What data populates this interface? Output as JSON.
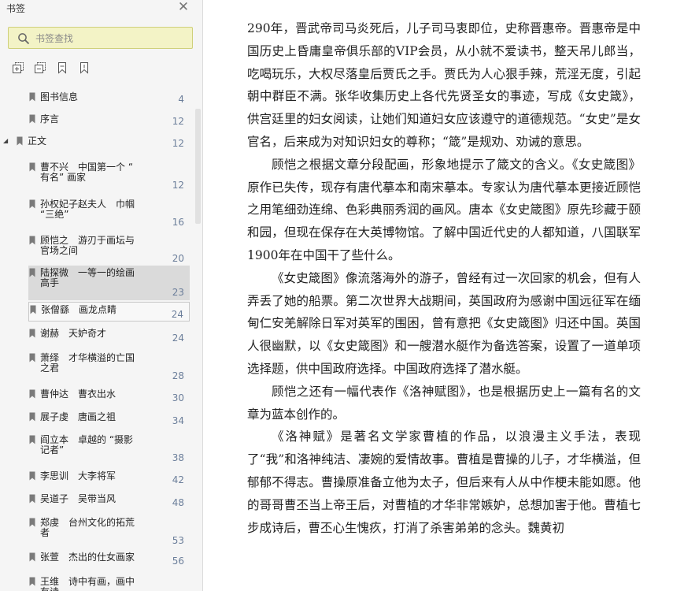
{
  "sidebar": {
    "title": "书签",
    "search": {
      "placeholder": "书签查找",
      "value": ""
    },
    "toolbar": [
      {
        "icon": "expand-all-bookmarks-icon"
      },
      {
        "icon": "collapse-all-bookmarks-icon"
      },
      {
        "icon": "bookmark-icon"
      },
      {
        "icon": "add-bookmark-icon"
      }
    ],
    "items": [
      {
        "label": "图书信息",
        "page": "4"
      },
      {
        "label": "序言",
        "page": "12"
      },
      {
        "label": "正文",
        "page": "12",
        "expanded": true
      },
      {
        "label": "曹不兴　中国第一个 “\n有名” 画家",
        "page": "12"
      },
      {
        "label": "孙权妃子赵夫人　巾帼\n“三绝”",
        "page": "16"
      },
      {
        "label": "顾恺之　游刃于画坛与\n官场之间",
        "page": "20"
      },
      {
        "label": "陆探微　一等一的绘画\n高手",
        "page": "23",
        "selected": true
      },
      {
        "label": "张僧繇　画龙点睛",
        "page": "24",
        "boxed": true
      },
      {
        "label": "谢赫　天妒奇才",
        "page": "24"
      },
      {
        "label": "萧绎　才华横溢的亡国\n之君",
        "page": "28"
      },
      {
        "label": "曹仲达　曹衣出水",
        "page": "30"
      },
      {
        "label": "展子虔　唐画之祖",
        "page": "34"
      },
      {
        "label": "阎立本　卓越的 “摄影\n记者”",
        "page": "38"
      },
      {
        "label": "李思训　大李将军",
        "page": "42"
      },
      {
        "label": "吴道子　吴带当风",
        "page": "48"
      },
      {
        "label": "郑虔　台州文化的拓荒\n者",
        "page": "53"
      },
      {
        "label": "张萱　杰出的仕女画家",
        "page": "56"
      },
      {
        "label": "王维　诗中有画，画中\n有诗",
        "page": ""
      }
    ]
  },
  "content": {
    "paragraphs": [
      "290年，晋武帝司马炎死后，儿子司马衷即位，史称晋惠帝。晋惠帝是中国历史上昏庸皇帝俱乐部的VIP会员，从小就不爱读书，整天吊儿郎当，吃喝玩乐，大权尽落皇后贾氏之手。贾氏为人心狠手辣，荒淫无度，引起朝中群臣不满。张华收集历史上各代先贤圣女的事迹，写成《女史箴》，供宫廷里的妇女阅读，让她们知道妇女应该遵守的道德规范。“女史”是女官名，后来成为对知识妇女的尊称；“箴”是规劝、劝诫的意思。",
      "顾恺之根据文章分段配画，形象地提示了箴文的含义。《女史箴图》原作已失传，现存有唐代摹本和南宋摹本。专家认为唐代摹本更接近顾恺之用笔细劲连绵、色彩典丽秀润的画风。唐本《女史箴图》原先珍藏于颐和园，但现在保存在大英博物馆。了解中国近代史的人都知道，八国联军1900年在中国干了些什么。",
      "《女史箴图》像流落海外的游子，曾经有过一次回家的机会，但有人弄丢了她的船票。第二次世界大战期间，英国政府为感谢中国远征军在缅甸仁安羌解除日军对英军的围困，曾有意把《女史箴图》归还中国。英国人很幽默，以《女史箴图》和一艘潜水艇作为备选答案，设置了一道单项选择题，供中国政府选择。中国政府选择了潜水艇。",
      "顾恺之还有一幅代表作《洛神赋图》，也是根据历史上一篇有名的文章为蓝本创作的。",
      "《洛神赋》是著名文学家曹植的作品，以浪漫主义手法，表现了“我”和洛神纯洁、凄婉的爱情故事。曹植是曹操的儿子，才华横溢，但郁郁不得志。曹操原准备立他为太子，但后来有人从中作梗未能如愿。他的哥哥曹丕当上帝王后，对曹植的才华非常嫉妒，总想加害于他。曹植七步成诗后，曹丕心生愧疚，打消了杀害弟弟的念头。魏黄初"
    ]
  }
}
